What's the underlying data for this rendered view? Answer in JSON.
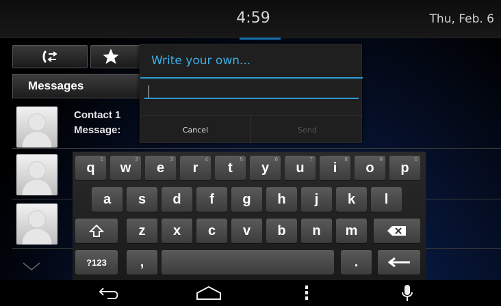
{
  "status": {
    "time": "4:59",
    "date": "Thu, Feb. 6"
  },
  "tabs": {
    "calls_icon": "swap-calls-icon",
    "favorites_icon": "star-icon"
  },
  "messages": {
    "header": "Messages",
    "rows": [
      {
        "name": "Contact 1",
        "message": "Message:"
      },
      {
        "name": "",
        "message": ""
      },
      {
        "name": "",
        "message": ""
      }
    ]
  },
  "dialog": {
    "title": "Write your own...",
    "input_value": "",
    "cancel_label": "Cancel",
    "send_label": "Send"
  },
  "keyboard": {
    "row1": [
      "q",
      "w",
      "e",
      "r",
      "t",
      "y",
      "u",
      "i",
      "o",
      "p"
    ],
    "row1_nums": [
      "1",
      "2",
      "3",
      "4",
      "5",
      "6",
      "7",
      "8",
      "9",
      "0"
    ],
    "row2": [
      "a",
      "s",
      "d",
      "f",
      "g",
      "h",
      "j",
      "k",
      "l"
    ],
    "row3": [
      "z",
      "x",
      "c",
      "v",
      "b",
      "n",
      "m"
    ],
    "symbols_label": "?123",
    "comma": ",",
    "period": "."
  },
  "colors": {
    "accent": "#2d9bd6",
    "title": "#3bb0e6"
  }
}
